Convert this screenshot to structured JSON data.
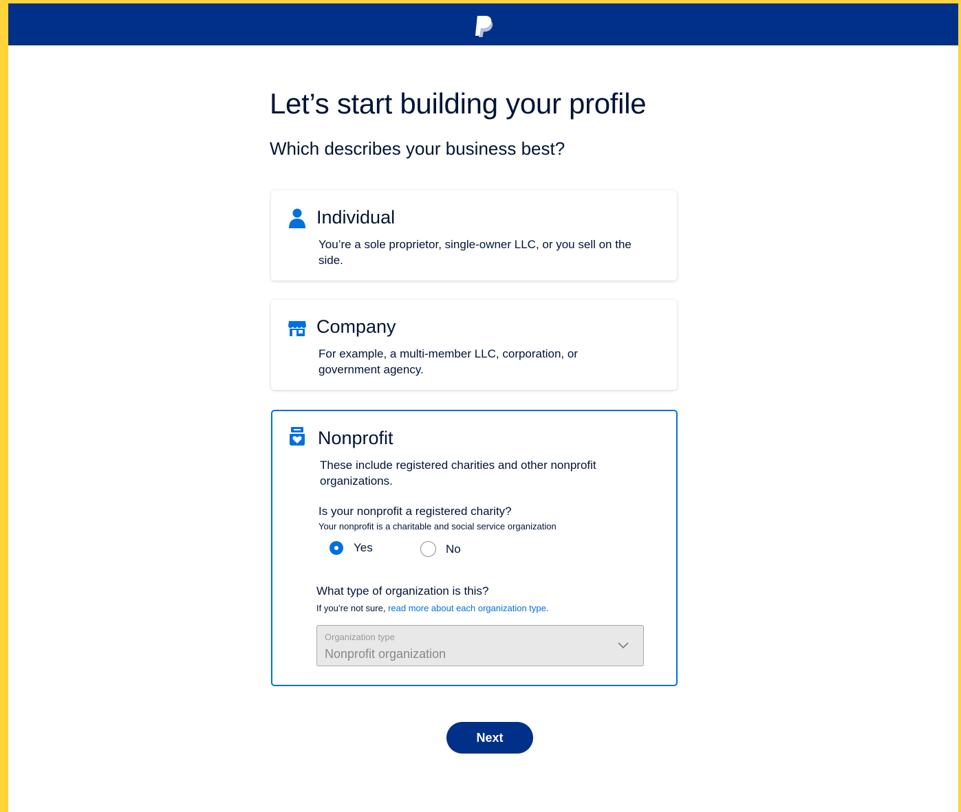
{
  "colors": {
    "brand_navy": "#003087",
    "accent_blue": "#0070e0",
    "frame_yellow": "#ffd43b"
  },
  "header": {
    "logo": "paypal-logo"
  },
  "page": {
    "title": "Let’s start building your profile",
    "subtitle": "Which describes your business best?"
  },
  "options": [
    {
      "icon": "person-icon",
      "title": "Individual",
      "description": "You’re a sole proprietor, single-owner LLC, or you sell on the side.",
      "selected": false
    },
    {
      "icon": "storefront-icon",
      "title": "Company",
      "description": "For example, a multi-member LLC, corporation, or government agency.",
      "selected": false
    },
    {
      "icon": "charity-box-icon",
      "title": "Nonprofit",
      "description": "These include registered charities and other nonprofit organizations.",
      "selected": true
    }
  ],
  "nonprofit": {
    "charity_question": "Is your nonprofit a registered charity?",
    "charity_hint": "Your nonprofit is a charitable and social service organization",
    "yes_label": "Yes",
    "no_label": "No",
    "selected_answer": "Yes",
    "org_question": "What type of organization is this?",
    "org_hint_prefix": "If you’re not sure, ",
    "org_hint_link": "read more about each organization type.",
    "org_select_label": "Organization type",
    "org_select_value": "Nonprofit organization"
  },
  "actions": {
    "next_label": "Next"
  }
}
